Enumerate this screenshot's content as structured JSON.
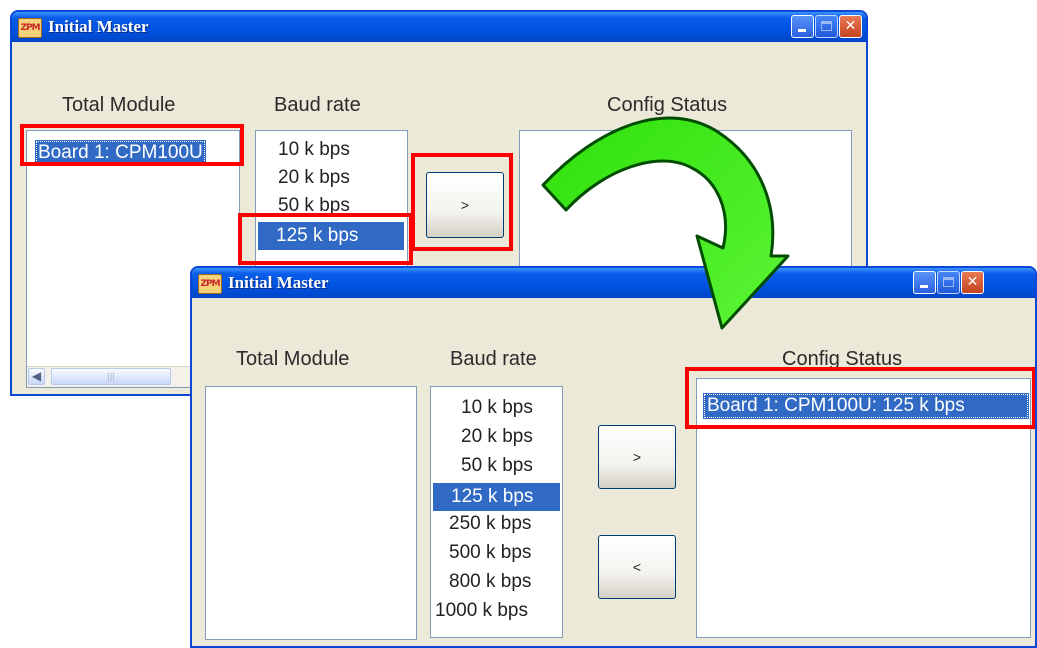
{
  "back_window": {
    "title": "Initial Master",
    "app_icon_text": "ZPM",
    "labels": {
      "total_module": "Total Module",
      "baud_rate": "Baud rate",
      "config_status": "Config Status"
    },
    "total_module_items": [
      "Board 1: CPM100U"
    ],
    "baud_items": [
      "10 k bps",
      "20 k bps",
      "50 k bps",
      "125 k bps"
    ],
    "selected_baud": "125 k bps",
    "add_button": ">"
  },
  "front_window": {
    "title": "Initial Master",
    "app_icon_text": "ZPM",
    "labels": {
      "total_module": "Total Module",
      "baud_rate": "Baud rate",
      "config_status": "Config Status"
    },
    "baud_items": [
      "10 k bps",
      "20 k bps",
      "50 k bps",
      "125 k bps",
      "250 k bps",
      "500 k bps",
      "800 k bps",
      "1000 k bps"
    ],
    "selected_baud": "125 k bps",
    "config_status_items": [
      "Board 1: CPM100U:  125 k bps"
    ],
    "add_button": ">",
    "remove_button": "<"
  },
  "colors": {
    "highlight_box": "#ff0000",
    "arrow": "#33ee11",
    "selection": "#316ac5",
    "titlebar": "#0054e3"
  }
}
